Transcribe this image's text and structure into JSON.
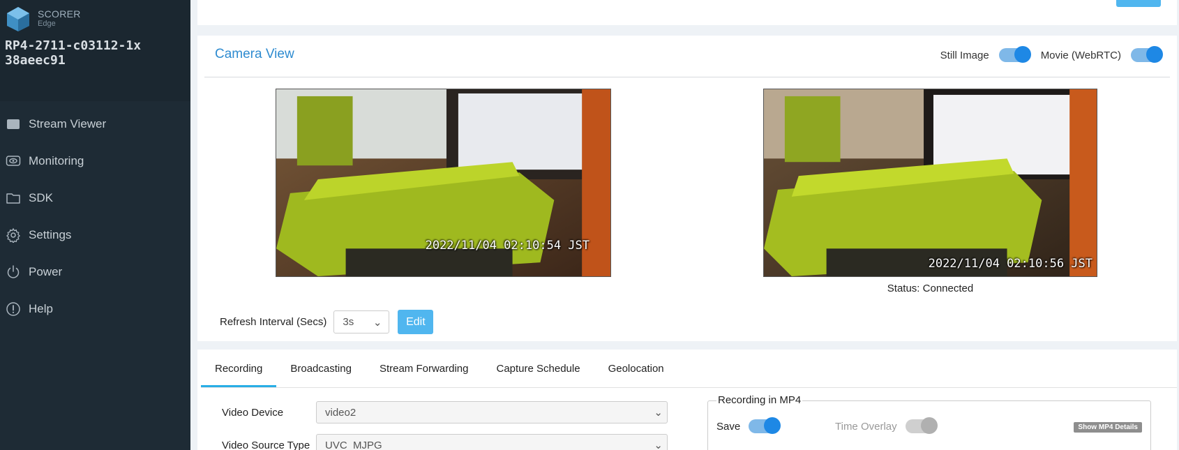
{
  "app": {
    "brand_line1": "SCORER",
    "brand_line2": "Edge",
    "device_id_line1": "RP4-2711-c03112-1x",
    "device_id_line2": "38aeec91"
  },
  "nav": [
    {
      "label": "Stream Viewer",
      "icon": "cast-icon"
    },
    {
      "label": "Monitoring",
      "icon": "eye-icon"
    },
    {
      "label": "SDK",
      "icon": "folder-icon"
    },
    {
      "label": "Settings",
      "icon": "gear-icon"
    },
    {
      "label": "Power",
      "icon": "power-icon"
    },
    {
      "label": "Help",
      "icon": "help-icon"
    }
  ],
  "camera_view": {
    "title": "Camera View",
    "still_image_label": "Still Image",
    "still_image_on": true,
    "movie_label": "Movie (WebRTC)",
    "movie_on": true,
    "still_timestamp": "2022/11/04 02:10:54 JST",
    "movie_timestamp": "2022/11/04 02:10:56 JST",
    "status_text": "Status: Connected",
    "refresh_label": "Refresh Interval (Secs)",
    "refresh_value": "3s",
    "edit_label": "Edit"
  },
  "tabs": [
    {
      "label": "Recording",
      "active": true
    },
    {
      "label": "Broadcasting",
      "active": false
    },
    {
      "label": "Stream Forwarding",
      "active": false
    },
    {
      "label": "Capture Schedule",
      "active": false
    },
    {
      "label": "Geolocation",
      "active": false
    }
  ],
  "recording": {
    "video_device_label": "Video Device",
    "video_device_value": "video2",
    "video_source_label": "Video Source Type",
    "video_source_value": "UVC_MJPG",
    "mp4_legend": "Recording in MP4",
    "save_label": "Save",
    "save_on": true,
    "time_overlay_label": "Time Overlay",
    "time_overlay_on": false,
    "show_mp4_details": "Show MP4 Details"
  },
  "colors": {
    "sidebar_bg": "#1e2b35",
    "accent": "#2e8bd0",
    "button": "#50b6ef",
    "tab_underline": "#29aee6"
  }
}
